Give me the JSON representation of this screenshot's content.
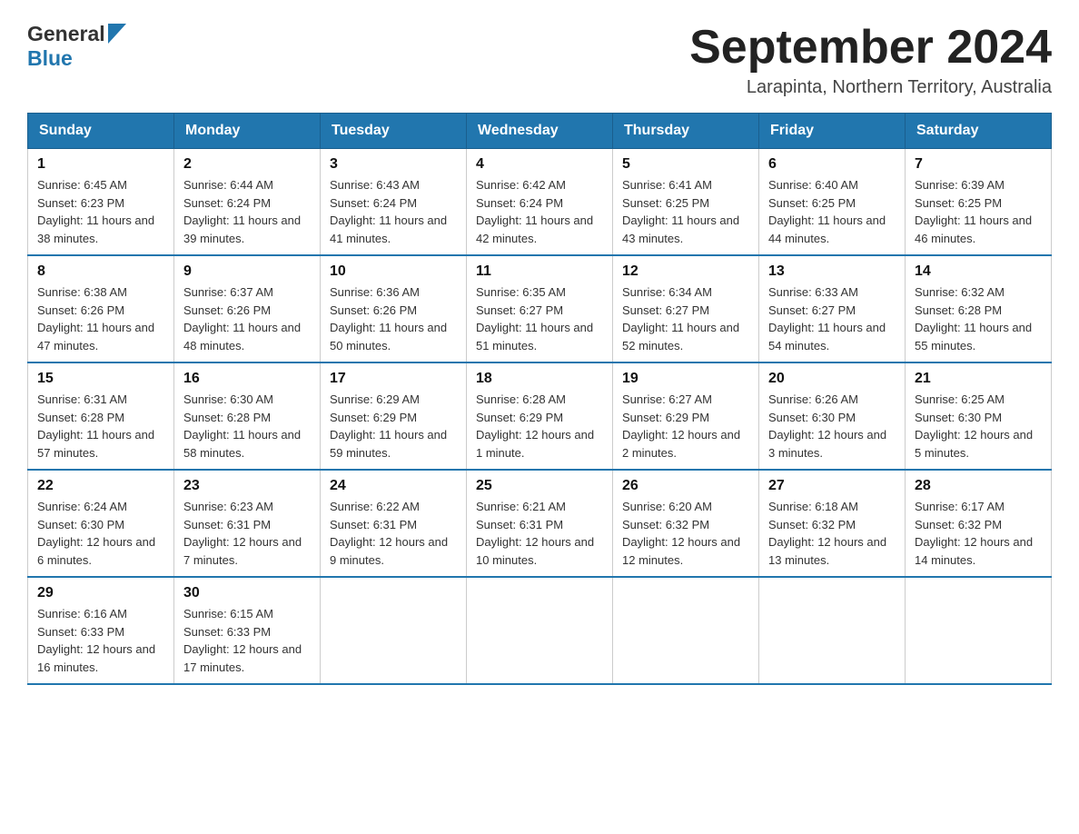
{
  "header": {
    "logo": {
      "general": "General",
      "blue": "Blue"
    },
    "title": "September 2024",
    "location": "Larapinta, Northern Territory, Australia"
  },
  "weekdays": [
    "Sunday",
    "Monday",
    "Tuesday",
    "Wednesday",
    "Thursday",
    "Friday",
    "Saturday"
  ],
  "weeks": [
    [
      {
        "day": "1",
        "sunrise": "6:45 AM",
        "sunset": "6:23 PM",
        "daylight": "11 hours and 38 minutes."
      },
      {
        "day": "2",
        "sunrise": "6:44 AM",
        "sunset": "6:24 PM",
        "daylight": "11 hours and 39 minutes."
      },
      {
        "day": "3",
        "sunrise": "6:43 AM",
        "sunset": "6:24 PM",
        "daylight": "11 hours and 41 minutes."
      },
      {
        "day": "4",
        "sunrise": "6:42 AM",
        "sunset": "6:24 PM",
        "daylight": "11 hours and 42 minutes."
      },
      {
        "day": "5",
        "sunrise": "6:41 AM",
        "sunset": "6:25 PM",
        "daylight": "11 hours and 43 minutes."
      },
      {
        "day": "6",
        "sunrise": "6:40 AM",
        "sunset": "6:25 PM",
        "daylight": "11 hours and 44 minutes."
      },
      {
        "day": "7",
        "sunrise": "6:39 AM",
        "sunset": "6:25 PM",
        "daylight": "11 hours and 46 minutes."
      }
    ],
    [
      {
        "day": "8",
        "sunrise": "6:38 AM",
        "sunset": "6:26 PM",
        "daylight": "11 hours and 47 minutes."
      },
      {
        "day": "9",
        "sunrise": "6:37 AM",
        "sunset": "6:26 PM",
        "daylight": "11 hours and 48 minutes."
      },
      {
        "day": "10",
        "sunrise": "6:36 AM",
        "sunset": "6:26 PM",
        "daylight": "11 hours and 50 minutes."
      },
      {
        "day": "11",
        "sunrise": "6:35 AM",
        "sunset": "6:27 PM",
        "daylight": "11 hours and 51 minutes."
      },
      {
        "day": "12",
        "sunrise": "6:34 AM",
        "sunset": "6:27 PM",
        "daylight": "11 hours and 52 minutes."
      },
      {
        "day": "13",
        "sunrise": "6:33 AM",
        "sunset": "6:27 PM",
        "daylight": "11 hours and 54 minutes."
      },
      {
        "day": "14",
        "sunrise": "6:32 AM",
        "sunset": "6:28 PM",
        "daylight": "11 hours and 55 minutes."
      }
    ],
    [
      {
        "day": "15",
        "sunrise": "6:31 AM",
        "sunset": "6:28 PM",
        "daylight": "11 hours and 57 minutes."
      },
      {
        "day": "16",
        "sunrise": "6:30 AM",
        "sunset": "6:28 PM",
        "daylight": "11 hours and 58 minutes."
      },
      {
        "day": "17",
        "sunrise": "6:29 AM",
        "sunset": "6:29 PM",
        "daylight": "11 hours and 59 minutes."
      },
      {
        "day": "18",
        "sunrise": "6:28 AM",
        "sunset": "6:29 PM",
        "daylight": "12 hours and 1 minute."
      },
      {
        "day": "19",
        "sunrise": "6:27 AM",
        "sunset": "6:29 PM",
        "daylight": "12 hours and 2 minutes."
      },
      {
        "day": "20",
        "sunrise": "6:26 AM",
        "sunset": "6:30 PM",
        "daylight": "12 hours and 3 minutes."
      },
      {
        "day": "21",
        "sunrise": "6:25 AM",
        "sunset": "6:30 PM",
        "daylight": "12 hours and 5 minutes."
      }
    ],
    [
      {
        "day": "22",
        "sunrise": "6:24 AM",
        "sunset": "6:30 PM",
        "daylight": "12 hours and 6 minutes."
      },
      {
        "day": "23",
        "sunrise": "6:23 AM",
        "sunset": "6:31 PM",
        "daylight": "12 hours and 7 minutes."
      },
      {
        "day": "24",
        "sunrise": "6:22 AM",
        "sunset": "6:31 PM",
        "daylight": "12 hours and 9 minutes."
      },
      {
        "day": "25",
        "sunrise": "6:21 AM",
        "sunset": "6:31 PM",
        "daylight": "12 hours and 10 minutes."
      },
      {
        "day": "26",
        "sunrise": "6:20 AM",
        "sunset": "6:32 PM",
        "daylight": "12 hours and 12 minutes."
      },
      {
        "day": "27",
        "sunrise": "6:18 AM",
        "sunset": "6:32 PM",
        "daylight": "12 hours and 13 minutes."
      },
      {
        "day": "28",
        "sunrise": "6:17 AM",
        "sunset": "6:32 PM",
        "daylight": "12 hours and 14 minutes."
      }
    ],
    [
      {
        "day": "29",
        "sunrise": "6:16 AM",
        "sunset": "6:33 PM",
        "daylight": "12 hours and 16 minutes."
      },
      {
        "day": "30",
        "sunrise": "6:15 AM",
        "sunset": "6:33 PM",
        "daylight": "12 hours and 17 minutes."
      },
      null,
      null,
      null,
      null,
      null
    ]
  ],
  "labels": {
    "sunrise": "Sunrise:",
    "sunset": "Sunset:",
    "daylight": "Daylight:"
  }
}
